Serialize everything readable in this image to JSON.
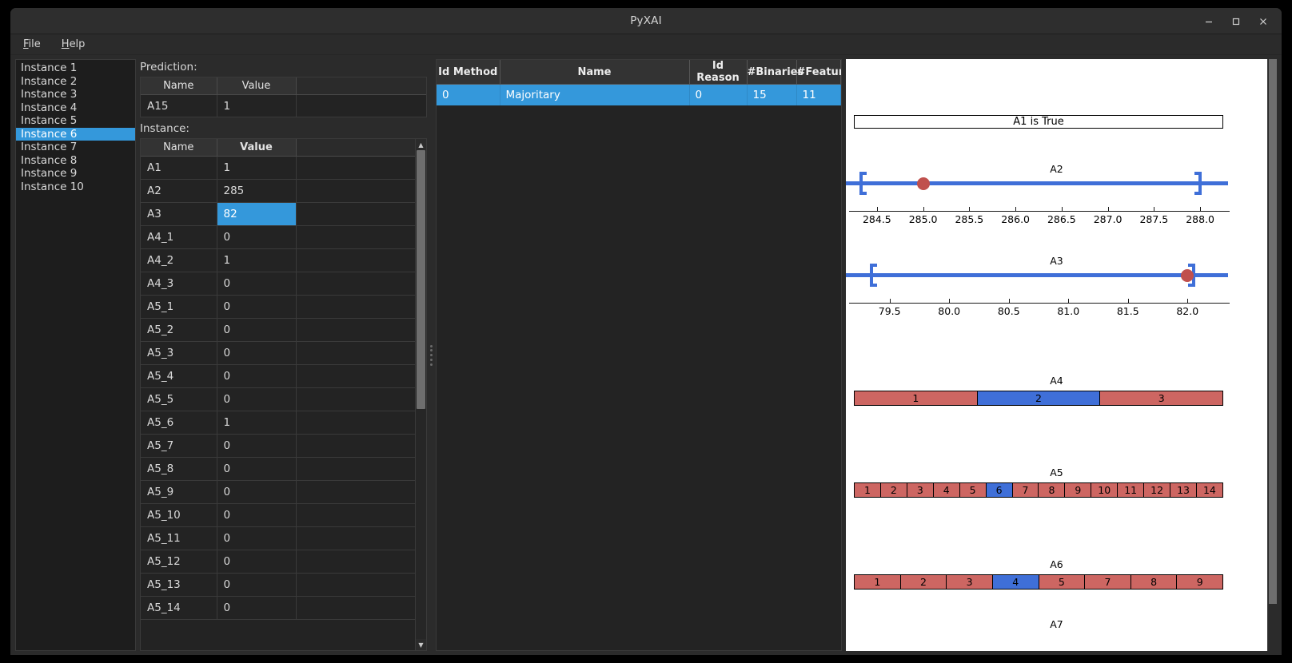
{
  "window": {
    "title": "PyXAI",
    "controls": {
      "minimize": "minimize-icon",
      "maximize": "maximize-icon",
      "close": "close-icon"
    }
  },
  "menubar": {
    "items": [
      {
        "label": "File"
      },
      {
        "label": "Help"
      }
    ]
  },
  "instances": {
    "items": [
      "Instance 1",
      "Instance 2",
      "Instance 3",
      "Instance 4",
      "Instance 5",
      "Instance 6",
      "Instance 7",
      "Instance 8",
      "Instance 9",
      "Instance 10"
    ],
    "selected_index": 5
  },
  "prediction": {
    "label": "Prediction:",
    "headers": [
      "Name",
      "Value"
    ],
    "rows": [
      {
        "name": "A15",
        "value": "1"
      }
    ]
  },
  "instance_table": {
    "label": "Instance:",
    "headers": [
      "Name",
      "Value"
    ],
    "selected_row_index": 2,
    "rows": [
      {
        "name": "A1",
        "value": "1"
      },
      {
        "name": "A2",
        "value": "285"
      },
      {
        "name": "A3",
        "value": "82"
      },
      {
        "name": "A4_1",
        "value": "0"
      },
      {
        "name": "A4_2",
        "value": "1"
      },
      {
        "name": "A4_3",
        "value": "0"
      },
      {
        "name": "A5_1",
        "value": "0"
      },
      {
        "name": "A5_2",
        "value": "0"
      },
      {
        "name": "A5_3",
        "value": "0"
      },
      {
        "name": "A5_4",
        "value": "0"
      },
      {
        "name": "A5_5",
        "value": "0"
      },
      {
        "name": "A5_6",
        "value": "1"
      },
      {
        "name": "A5_7",
        "value": "0"
      },
      {
        "name": "A5_8",
        "value": "0"
      },
      {
        "name": "A5_9",
        "value": "0"
      },
      {
        "name": "A5_10",
        "value": "0"
      },
      {
        "name": "A5_11",
        "value": "0"
      },
      {
        "name": "A5_12",
        "value": "0"
      },
      {
        "name": "A5_13",
        "value": "0"
      },
      {
        "name": "A5_14",
        "value": "0"
      }
    ]
  },
  "method_table": {
    "headers": [
      "Id Method",
      "Name",
      "Id Reason",
      "#Binaries",
      "#Features"
    ],
    "rows": [
      {
        "id_method": "0",
        "name": "Majoritary",
        "id_reason": "0",
        "binaries": "15",
        "features": "11"
      }
    ]
  },
  "colors": {
    "accent_blue": "#3498db",
    "plot_blue": "#3f6fd8",
    "plot_red": "#cd6662",
    "dot_red": "#c0504d",
    "window_bg": "#2b2b2b",
    "panel_bg": "#232323"
  },
  "chart_data": [
    {
      "type": "boolean",
      "title": "A1",
      "text": "A1 is True"
    },
    {
      "type": "interval",
      "title": "A2",
      "tick_labels": [
        "284.5",
        "285.0",
        "285.5",
        "286.0",
        "286.5",
        "287.0",
        "287.5",
        "288.0"
      ],
      "ticks": [
        284.5,
        285.0,
        285.5,
        286.0,
        286.5,
        287.0,
        287.5,
        288.0
      ],
      "xlim": [
        284.25,
        288.25
      ],
      "interval_min": 284.33,
      "interval_max": 288.0,
      "value": 285.0,
      "value_label": "285"
    },
    {
      "type": "interval",
      "title": "A3",
      "tick_labels": [
        "79.5",
        "80.0",
        "80.5",
        "81.0",
        "81.5",
        "82.0"
      ],
      "ticks": [
        79.5,
        80.0,
        80.5,
        81.0,
        81.5,
        82.0
      ],
      "xlim": [
        79.2,
        82.3
      ],
      "interval_min": 79.35,
      "interval_max": 82.05,
      "value": 82.0,
      "value_label": "82"
    },
    {
      "type": "categorical",
      "title": "A4",
      "categories": [
        "1",
        "2",
        "3"
      ],
      "selected": "2"
    },
    {
      "type": "categorical",
      "title": "A5",
      "categories": [
        "1",
        "2",
        "3",
        "4",
        "5",
        "6",
        "7",
        "8",
        "9",
        "10",
        "11",
        "12",
        "13",
        "14"
      ],
      "selected": "6"
    },
    {
      "type": "categorical",
      "title": "A6",
      "categories": [
        "1",
        "2",
        "3",
        "4",
        "5",
        "7",
        "8",
        "9"
      ],
      "selected": "4"
    },
    {
      "type": "categorical",
      "title": "A7",
      "categories": [],
      "selected": null
    }
  ]
}
